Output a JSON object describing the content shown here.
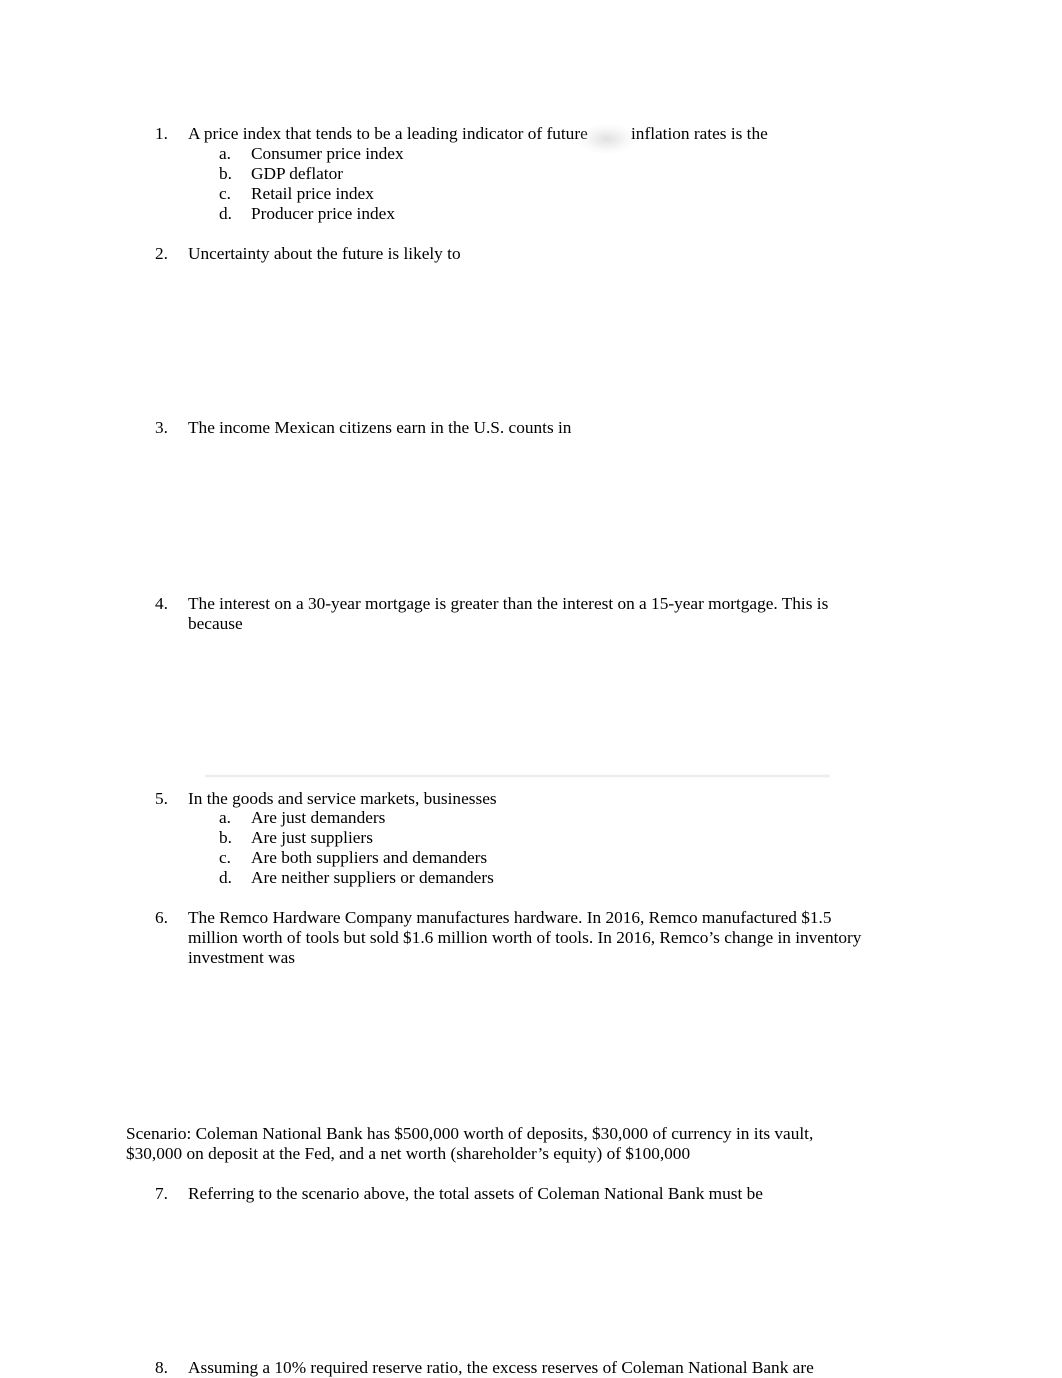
{
  "questions": [
    {
      "number": "1.",
      "lines": [
        "A price index that tends to be a leading indicator of future",
        "inflation rates is the"
      ],
      "options": [
        {
          "letter": "a.",
          "text": "Consumer price index"
        },
        {
          "letter": "b.",
          "text": "GDP deflator"
        },
        {
          "letter": "c.",
          "text": "Retail price index"
        },
        {
          "letter": "d.",
          "text": "Producer price index"
        }
      ]
    },
    {
      "number": "2.",
      "lines": [
        "Uncertainty about the future is likely to"
      ]
    },
    {
      "number": "3.",
      "lines": [
        "The income Mexican citizens earn in the U.S. counts in"
      ]
    },
    {
      "number": "4.",
      "lines": [
        "The interest on a 30-year mortgage is greater than the interest on a 15-year mortgage. This is",
        "because"
      ]
    },
    {
      "number": "5.",
      "lines": [
        "In the goods and service markets, businesses"
      ],
      "options": [
        {
          "letter": "a.",
          "text": "Are just demanders"
        },
        {
          "letter": "b.",
          "text": "Are just suppliers"
        },
        {
          "letter": "c.",
          "text": "Are both suppliers and demanders"
        },
        {
          "letter": "d.",
          "text": "Are neither suppliers or demanders"
        }
      ]
    },
    {
      "number": "6.",
      "lines": [
        "The Remco Hardware Company manufactures hardware. In 2016, Remco manufactured $1.5",
        "million worth of tools but sold $1.6 million worth of tools. In 2016, Remco’s change in inventory",
        "investment was"
      ]
    },
    {
      "number": "7.",
      "lines": [
        "Referring to the scenario above, the total assets of Coleman National Bank must be"
      ]
    },
    {
      "number": "8.",
      "lines": [
        "Assuming a 10% required reserve ratio, the excess reserves of Coleman National Bank are"
      ]
    }
  ],
  "scenario": {
    "lines": [
      "Scenario: Coleman National Bank has $500,000 worth of deposits, $30,000 of currency in its vault,",
      "$30,000 on deposit at the Fed, and a net worth (shareholder’s equity) of $100,000"
    ]
  }
}
